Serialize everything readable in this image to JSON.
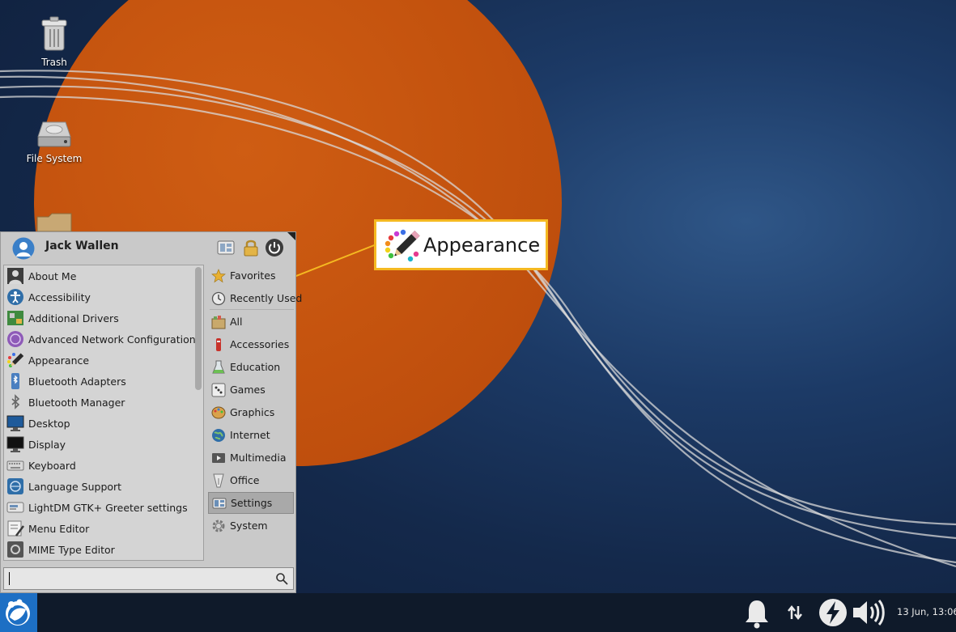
{
  "desktop": {
    "icons": [
      {
        "label": "Trash",
        "icon": "trash-icon"
      },
      {
        "label": "File System",
        "icon": "hard-drive-icon"
      },
      {
        "label": "",
        "icon": "folder-icon"
      }
    ]
  },
  "menu": {
    "user_name": "Jack Wallen",
    "header_buttons": [
      "settings-manager-icon",
      "lock-icon",
      "power-icon"
    ],
    "apps": [
      {
        "label": "About Me",
        "icon": "about-me-icon"
      },
      {
        "label": "Accessibility",
        "icon": "accessibility-icon"
      },
      {
        "label": "Additional Drivers",
        "icon": "drivers-icon"
      },
      {
        "label": "Advanced Network Configuration",
        "icon": "network-config-icon"
      },
      {
        "label": "Appearance",
        "icon": "appearance-icon"
      },
      {
        "label": "Bluetooth Adapters",
        "icon": "bluetooth-adapters-icon"
      },
      {
        "label": "Bluetooth Manager",
        "icon": "bluetooth-manager-icon"
      },
      {
        "label": "Desktop",
        "icon": "desktop-icon"
      },
      {
        "label": "Display",
        "icon": "display-icon"
      },
      {
        "label": "Keyboard",
        "icon": "keyboard-icon"
      },
      {
        "label": "Language Support",
        "icon": "language-icon"
      },
      {
        "label": "LightDM GTK+ Greeter settings",
        "icon": "greeter-icon"
      },
      {
        "label": "Menu Editor",
        "icon": "menu-editor-icon"
      },
      {
        "label": "MIME Type Editor",
        "icon": "mime-editor-icon"
      }
    ],
    "categories": [
      {
        "label": "Favorites",
        "icon": "star-icon"
      },
      {
        "label": "Recently Used",
        "icon": "clock-icon"
      },
      {
        "label": "All",
        "icon": "all-icon"
      },
      {
        "label": "Accessories",
        "icon": "accessories-icon"
      },
      {
        "label": "Education",
        "icon": "education-icon"
      },
      {
        "label": "Games",
        "icon": "games-icon"
      },
      {
        "label": "Graphics",
        "icon": "graphics-icon"
      },
      {
        "label": "Internet",
        "icon": "globe-icon"
      },
      {
        "label": "Multimedia",
        "icon": "multimedia-icon"
      },
      {
        "label": "Office",
        "icon": "office-icon"
      },
      {
        "label": "Settings",
        "icon": "settings-icon"
      },
      {
        "label": "System",
        "icon": "system-gear-icon"
      }
    ],
    "selected_category": "Settings",
    "search": {
      "value": "",
      "placeholder": ""
    }
  },
  "callout": {
    "label": "Appearance",
    "color": "#f5b921"
  },
  "taskbar": {
    "clock": "13 Jun, 13:06",
    "tray": [
      "bell-icon",
      "network-arrows-icon",
      "power-manager-icon",
      "volume-icon"
    ]
  },
  "colors": {
    "accent": "#1d6fc4",
    "callout_border": "#f5b921",
    "wallpaper_orange": "#c3520e",
    "wallpaper_blue": "#1c3a66"
  }
}
